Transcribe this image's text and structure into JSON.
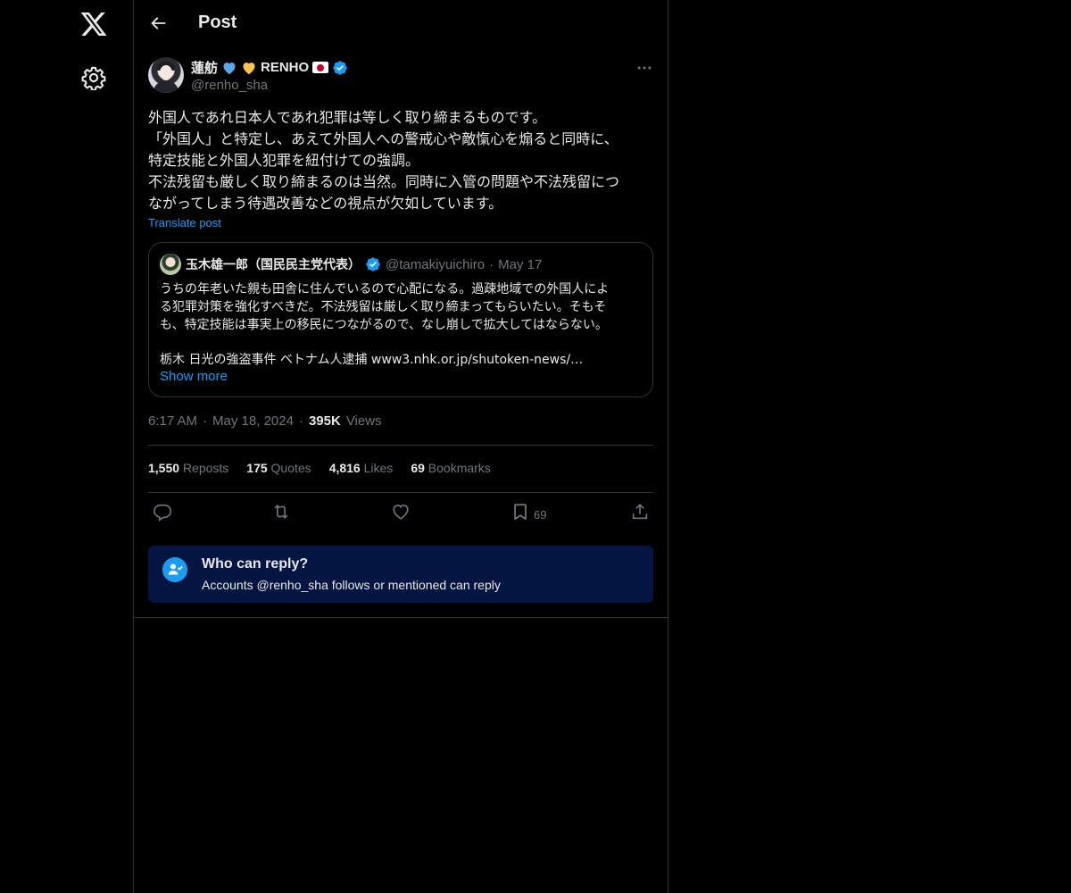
{
  "header": {
    "title": "Post"
  },
  "author": {
    "name": "蓮舫",
    "name_suffix": "RENHO",
    "handle": "@renho_sha"
  },
  "post": {
    "text": "外国人であれ日本人であれ犯罪は等しく取り締まるものです。\n「外国人」と特定し、あえて外国人への警戒心や敵愾心を煽ると同時に、\n特定技能と外国人犯罪を紐付けての強調。\n不法残留も厳しく取り締まるのは当然。同時に入管の問題や不法残留につ\nながってしまう待遇改善などの視点が欠如しています。",
    "translate_label": "Translate post",
    "time": "6:17 AM",
    "date": "May 18, 2024",
    "views_count": "395K",
    "views_label": "Views"
  },
  "quote": {
    "name": "玉木雄一郎（国民民主党代表）",
    "handle": "@tamakiyuichiro",
    "date": "May 17",
    "text": "うちの年老いた親も田舎に住んでいるので心配になる。過疎地域での外国人によ\nる犯罪対策を強化すべきだ。不法残留は厳しく取り締まってもらいたい。そもそ\nも、特定技能は事実上の移民につながるので、なし崩しで拡大してはならない。",
    "link_text": "栃木 日光の強盗事件 ベトナム人逮捕 www3.nhk.or.jp/shutoken-news/…",
    "show_more": "Show more"
  },
  "stats": [
    {
      "count": "1,550",
      "label": "Reposts"
    },
    {
      "count": "175",
      "label": "Quotes"
    },
    {
      "count": "4,816",
      "label": "Likes"
    },
    {
      "count": "69",
      "label": "Bookmarks"
    }
  ],
  "actions": {
    "bookmark_count": "69"
  },
  "reply_settings": {
    "title": "Who can reply?",
    "subtitle": "Accounts @renho_sha follows or mentioned can reply"
  },
  "colors": {
    "background": "#000000",
    "accent": "#1d9bf0",
    "muted": "#71767b",
    "border": "#2f3336",
    "reply_box": "#031540"
  },
  "icons": {
    "logo": "x-logo-icon",
    "settings": "gear-icon",
    "back": "arrow-left-icon",
    "more": "more-horizontal-icon",
    "reply": "reply-icon",
    "repost": "repost-icon",
    "like": "heart-icon",
    "bookmark": "bookmark-icon",
    "share": "share-icon"
  }
}
